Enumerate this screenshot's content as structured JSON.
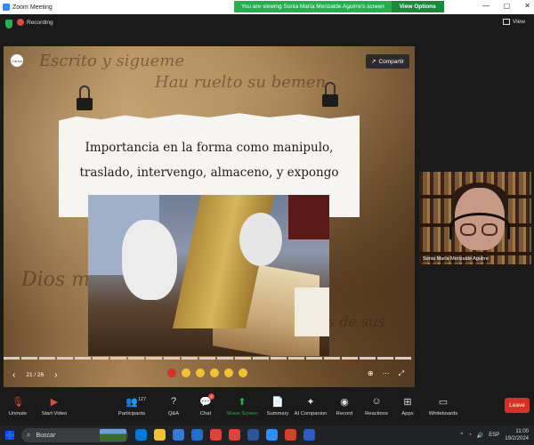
{
  "titlebar": {
    "title": "Zoom Meeting",
    "minimize": "—",
    "maximize": "▢",
    "close": "✕"
  },
  "share_banner": {
    "text": "You are viewing Sonia María Merizalde Aguirre's screen",
    "view_options": "View Options"
  },
  "status": {
    "recording": "Recording",
    "view": "View"
  },
  "slide": {
    "logo": "Canva",
    "compartir": "Compartir",
    "title": "Importancia en la forma como manipulo, traslado, intervengo, almaceno, y expongo",
    "counter": "21 / 26",
    "prev": "‹",
    "next": "›",
    "more": "⋯",
    "fullscreen": "⤢",
    "zoom": "⊕"
  },
  "participant": {
    "name": "Sonia María Merizalde Aguirre"
  },
  "toolbar": {
    "unmute": "Unmute",
    "start_video": "Start Video",
    "participants": "Participants",
    "participants_count": "127",
    "qa": "Q&A",
    "chat": "Chat",
    "chat_badge": "4",
    "share_screen": "Share Screen",
    "summary": "Summary",
    "ai_companion": "AI Companion",
    "record": "Record",
    "reactions": "Reactions",
    "apps": "Apps",
    "whiteboards": "Whiteboards",
    "leave": "Leave"
  },
  "taskbar": {
    "search_placeholder": "Buscar",
    "language": "ESP",
    "time": "11:00",
    "date": "19/2/2024"
  },
  "colors": {
    "accent_green": "#23b14d",
    "leave_red": "#d93025",
    "record_red": "#e0483a"
  }
}
